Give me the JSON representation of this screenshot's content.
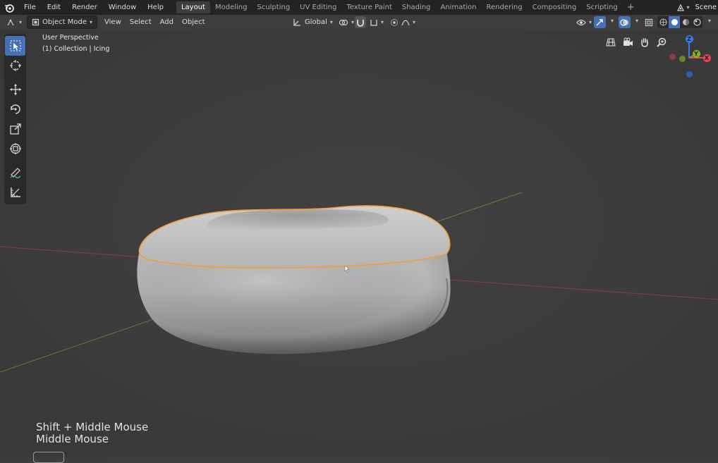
{
  "topbar": {
    "menu": [
      "File",
      "Edit",
      "Render",
      "Window",
      "Help"
    ],
    "tabs": [
      {
        "label": "Layout",
        "active": true
      },
      {
        "label": "Modeling",
        "active": false
      },
      {
        "label": "Sculpting",
        "active": false
      },
      {
        "label": "UV Editing",
        "active": false
      },
      {
        "label": "Texture Paint",
        "active": false
      },
      {
        "label": "Shading",
        "active": false
      },
      {
        "label": "Animation",
        "active": false
      },
      {
        "label": "Rendering",
        "active": false
      },
      {
        "label": "Compositing",
        "active": false
      },
      {
        "label": "Scripting",
        "active": false
      }
    ],
    "add_tab": "+",
    "scene_label": "Scene"
  },
  "header": {
    "mode": "Object Mode",
    "menu": [
      "View",
      "Select",
      "Add",
      "Object"
    ],
    "orientation": "Global"
  },
  "viewport": {
    "perspective": "User Perspective",
    "collection": "(1) Collection | Icing",
    "key_hints": [
      "Shift + Middle Mouse",
      "Middle Mouse"
    ]
  },
  "gizmo": {
    "z_label": "Z",
    "y_label": "Y",
    "x_label": "X",
    "colors": {
      "x": "#e94458",
      "y": "#86b02a",
      "z": "#3b7be8"
    }
  },
  "colors": {
    "accent": "#4672b5",
    "selection_outline": "#f29d38",
    "background": "#3d3d3d",
    "topbar": "#232323"
  },
  "icons": {
    "logo": "blender-logo-icon",
    "tools": [
      "select-box-icon",
      "cursor-icon",
      "move-icon",
      "rotate-icon",
      "scale-icon",
      "transform-icon",
      "annotate-icon",
      "measure-icon"
    ],
    "nav": [
      "toggle-perspective-icon",
      "camera-view-icon",
      "pan-hand-icon",
      "zoom-icon"
    ]
  }
}
